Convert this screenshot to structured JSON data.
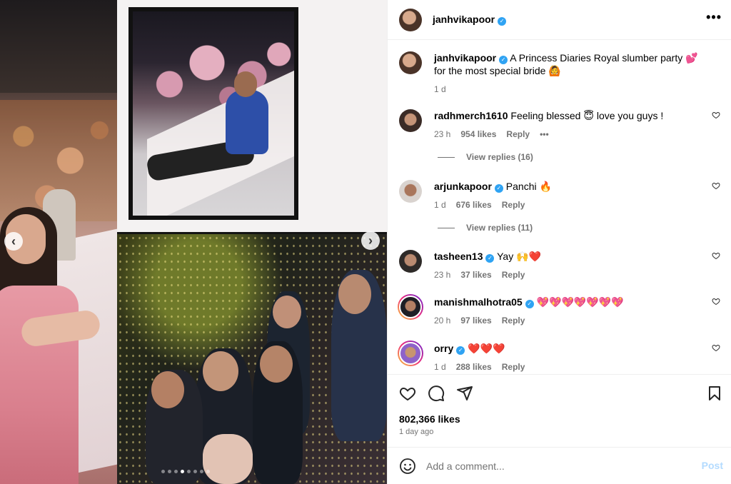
{
  "post": {
    "owner": "janhvikapoor",
    "caption": "A Princess Diaries Royal slumber party 💕 for the most special bride 🙆",
    "caption_age": "1 d",
    "likes": "802,366 likes",
    "posted": "1 day ago"
  },
  "header": {
    "more_label": "•••"
  },
  "carousel": {
    "prev_glyph": "‹",
    "next_glyph": "›",
    "slide_count": 8,
    "active_slide": 4
  },
  "comments": [
    {
      "user": "radhmerch1610",
      "text": "Feeling blessed 😇 love you guys !",
      "age": "23 h",
      "likes": "954 likes",
      "reply": "Reply",
      "more": "•••",
      "replies": "View replies (16)"
    },
    {
      "user": "arjunkapoor",
      "text": "Panchi 🔥",
      "age": "1 d",
      "likes": "676 likes",
      "reply": "Reply",
      "replies": "View replies (11)"
    },
    {
      "user": "tasheen13",
      "text": "Yay 🙌❤️",
      "age": "23 h",
      "likes": "37 likes",
      "reply": "Reply"
    },
    {
      "user": "manishmalhotra05",
      "text": "💖💖💖💖💖💖💖",
      "age": "20 h",
      "likes": "97 likes",
      "reply": "Reply"
    },
    {
      "user": "orry",
      "text": "❤️❤️❤️",
      "age": "1 d",
      "likes": "288 likes",
      "reply": "Reply"
    }
  ],
  "add_comment": {
    "placeholder": "Add a comment...",
    "post_label": "Post"
  },
  "icons": [
    "heart-icon",
    "comment-icon",
    "share-icon",
    "bookmark-icon",
    "emoji-icon",
    "verified-badge-icon",
    "more-options-icon"
  ]
}
